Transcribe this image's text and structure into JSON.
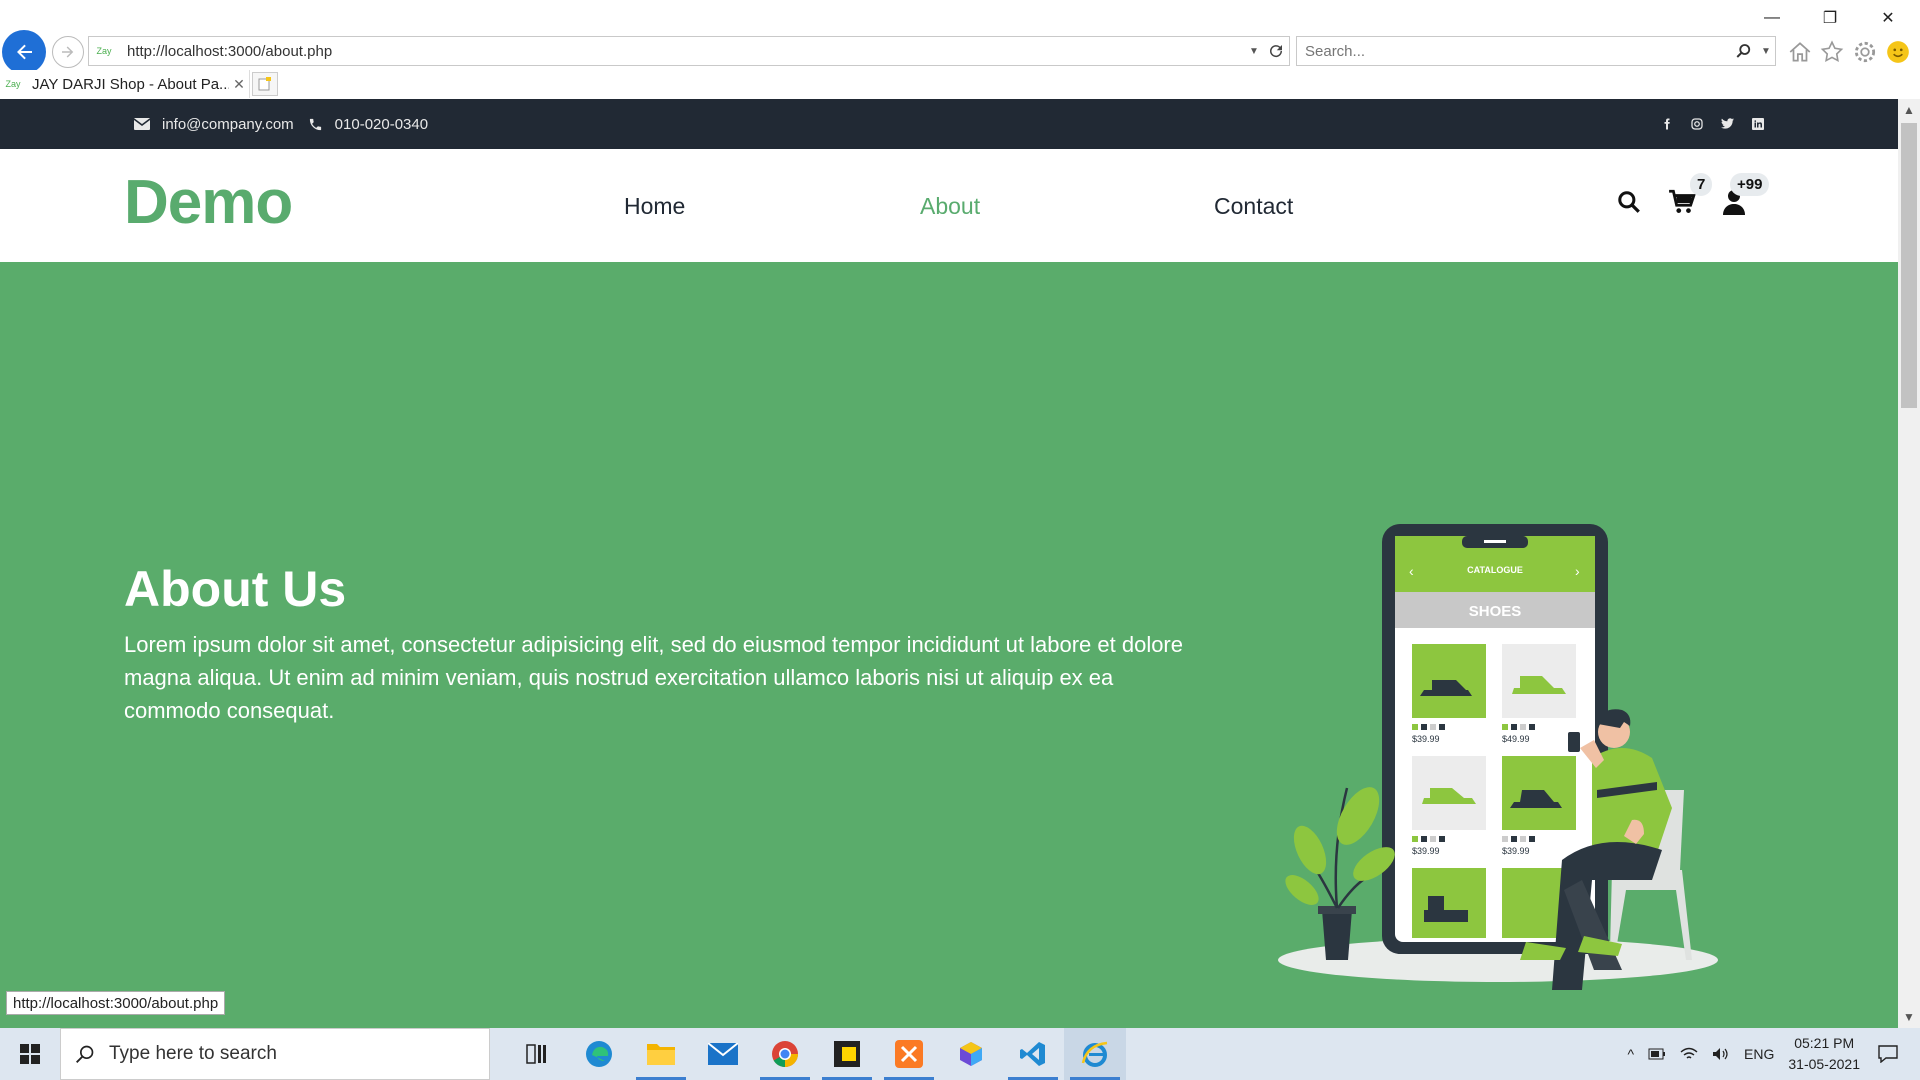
{
  "browser": {
    "url": "http://localhost:3000/about.php",
    "search_placeholder": "Search...",
    "tab_title": "JAY DARJI Shop - About Pa...",
    "favicon_text": "Zay",
    "status_url": "http://localhost:3000/about.php"
  },
  "topbar": {
    "email": "info@company.com",
    "phone": "010-020-0340",
    "social": [
      "facebook-icon",
      "instagram-icon",
      "twitter-icon",
      "linkedin-icon"
    ]
  },
  "header": {
    "logo": "Demo",
    "menu": [
      {
        "label": "Home",
        "active": false
      },
      {
        "label": "About",
        "active": true
      },
      {
        "label": "Contact",
        "active": false
      }
    ],
    "cart_count": "7",
    "user_count": "+99"
  },
  "hero": {
    "title": "About Us",
    "text": "Lorem ipsum dolor sit amet, consectetur adipisicing elit, sed do eiusmod tempor incididunt ut labore et dolore magna aliqua. Ut enim ad minim veniam, quis nostrud exercitation ullamco laboris nisi ut aliquip ex ea commodo consequat.",
    "illustration": {
      "header": "CATALOGUE",
      "category": "SHOES",
      "prices": [
        "$39.99",
        "$49.99",
        "$39.99",
        "$39.99"
      ]
    }
  },
  "taskbar": {
    "search_placeholder": "Type here to search",
    "lang": "ENG",
    "time": "05:21 PM",
    "date": "31-05-2021"
  },
  "colors": {
    "brand_green": "#59ab6e",
    "hero_bg": "#5aac6b",
    "topbar_bg": "#212934",
    "phone_accent": "#8dc63f"
  }
}
